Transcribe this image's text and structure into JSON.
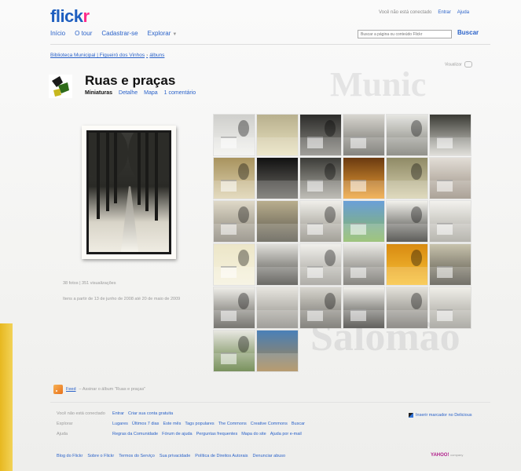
{
  "brand": {
    "logo_part1": "flick",
    "logo_part2": "r"
  },
  "top_links": [
    "Você não está conectado",
    "Entrar",
    "Ajuda"
  ],
  "nav": [
    "Início",
    "O tour",
    "Cadastrar-se",
    "Explorar"
  ],
  "search": {
    "placeholder": "Buscar a página ou conteúdo Flickr",
    "button": "Buscar"
  },
  "breadcrumb": {
    "owner": "Biblioteca Municipal | Figueiró dos Vinhos",
    "section": "álbuns"
  },
  "set": {
    "title": "Ruas e praças",
    "tabs": {
      "active": "Miniaturas",
      "detail": "Detalhe",
      "map": "Mapa",
      "comments": "1 comentário"
    }
  },
  "view_selector": "Visualizar",
  "featured": {
    "meta_counts": "38 fotos | 351 visualizações",
    "meta_dates": "Itens a partir de 13 de junho de 2008 até 20 de maio de 2009"
  },
  "thumbnails": [
    {
      "c1": "#cfcfcc",
      "c2": "#f2f2ef"
    },
    {
      "c1": "#b8b08e",
      "c2": "#e9e2c0"
    },
    {
      "c1": "#2c2c2a",
      "c2": "#8c8a84"
    },
    {
      "c1": "#d8d6d0",
      "c2": "#6b6a64"
    },
    {
      "c1": "#e6e6e2",
      "c2": "#7a7a72"
    },
    {
      "c1": "#3a3a34",
      "c2": "#d9d8d2"
    },
    {
      "c1": "#a8935e",
      "c2": "#ded3b1"
    },
    {
      "c1": "#111",
      "c2": "#6e6c66"
    },
    {
      "c1": "#3c3c38",
      "c2": "#b0aea6"
    },
    {
      "c1": "#6a3a10",
      "c2": "#f0a43a"
    },
    {
      "c1": "#8f8a66",
      "c2": "#d8d2b0"
    },
    {
      "c1": "#e2ddd6",
      "c2": "#9a8f82"
    },
    {
      "c1": "#dfd9c8",
      "c2": "#8a857a"
    },
    {
      "c1": "#b9ae8e",
      "c2": "#5a574c"
    },
    {
      "c1": "#f0efea",
      "c2": "#8f8c82"
    },
    {
      "c1": "#6a9fd8",
      "c2": "#8ab860"
    },
    {
      "c1": "#f2f1ec",
      "c2": "#3a3a36"
    },
    {
      "c1": "#f3f2ee",
      "c2": "#a8a69e"
    },
    {
      "c1": "#ece6c8",
      "c2": "#f6f2de"
    },
    {
      "c1": "#e0dfda",
      "c2": "#4a4944"
    },
    {
      "c1": "#f1f0ec",
      "c2": "#9e9c95"
    },
    {
      "c1": "#e9e8e3",
      "c2": "#6e6c66"
    },
    {
      "c1": "#d88a10",
      "c2": "#f8c23a"
    },
    {
      "c1": "#c8c3ad",
      "c2": "#555249"
    },
    {
      "c1": "#efeee9",
      "c2": "#5a5852"
    },
    {
      "c1": "#e7e5df",
      "c2": "#8c8a84"
    },
    {
      "c1": "#d8d6cf",
      "c2": "#6a6862"
    },
    {
      "c1": "#f1f0eb",
      "c2": "#3f3e3a"
    },
    {
      "c1": "#e3e1da",
      "c2": "#777570"
    },
    {
      "c1": "#f0efe9",
      "c2": "#9d9b94"
    },
    {
      "c1": "#e8e7e1",
      "c2": "#5c7a3a"
    },
    {
      "c1": "#4a80b8",
      "c2": "#a88650"
    }
  ],
  "feed": {
    "link": "Feed",
    "text": "– Assinar o álbum \"Ruas e praças\""
  },
  "footer_rows": [
    {
      "label": "Você não está conectado",
      "links": [
        "Entrar",
        "Criar sua conta gratuita"
      ]
    },
    {
      "label": "Explorar",
      "links": [
        "Lugares",
        "Últimos 7 dias",
        "Este mês",
        "Tags populares",
        "The Commons",
        "Creative Commons",
        "Buscar"
      ]
    },
    {
      "label": "Ajuda",
      "links": [
        "Regras da Comunidade",
        "Fórum de ajuda",
        "Perguntas frequentes",
        "Mapa do site",
        "Ajuda por e-mail"
      ]
    }
  ],
  "delicious": "Inserir marcador no Delicious",
  "bottom_links": [
    "Blog do Flickr",
    "Sobre o Flickr",
    "Termos do Serviço",
    "Sua privacidade",
    "Política de Direitos Autorais",
    "Denunciar abuso"
  ],
  "yahoo": {
    "name": "YAHOO!",
    "sub": "company"
  }
}
